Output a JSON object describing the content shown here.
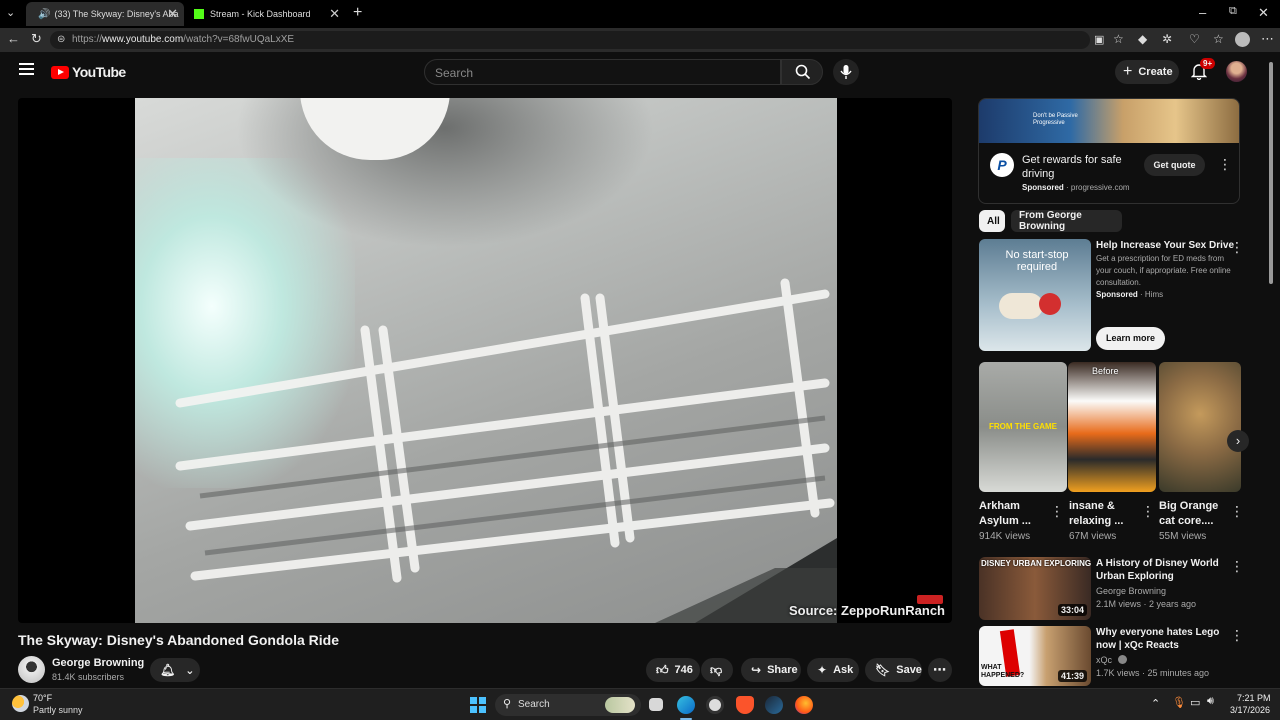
{
  "browser": {
    "tabs": [
      {
        "title": "(33) The Skyway: Disney's Aba",
        "active": true
      },
      {
        "title": "Stream - Kick Dashboard",
        "active": false
      }
    ],
    "url_prefix": "https://",
    "url_domain": "www.youtube.com",
    "url_path": "/watch?v=68fwUQaLxXE"
  },
  "header": {
    "logo": "YouTube",
    "search_placeholder": "Search",
    "create_label": "Create",
    "notification_badge": "9+"
  },
  "video": {
    "title": "The Skyway: Disney's Abandoned Gondola Ride",
    "source_overlay": "Source: ZeppoRunRanch",
    "channel": "George Browning",
    "subscribers": "81.4K subscribers",
    "likes": "746",
    "share_label": "Share",
    "ask_label": "Ask",
    "save_label": "Save"
  },
  "ad": {
    "banner_text": "Don't be Passive Progressive",
    "title": "Get rewards for safe driving",
    "sponsored": "Sponsored",
    "domain": "progressive.com",
    "cta": "Get quote"
  },
  "chips": [
    "All",
    "From George Browning"
  ],
  "promo": {
    "thumb_text": "No start-stop required",
    "title": "Help Increase Your Sex Drive",
    "description": "Get a prescription for ED meds from your couch, if appropriate. Free online consultation.",
    "sponsored": "Sponsored",
    "advertiser": "Hims",
    "cta": "Learn more"
  },
  "shorts": [
    {
      "title": "Arkham Asylum ...",
      "views": "914K views",
      "thumb_text": "FROM THE GAME",
      "color": "#8c8f8a"
    },
    {
      "title": "insane & relaxing ...",
      "views": "67M views",
      "thumb_text": "Before",
      "color": "#3a2a22"
    },
    {
      "title": "Big Orange cat core....",
      "views": "55M views",
      "thumb_text": "",
      "color": "#8a6a44"
    }
  ],
  "recommended": [
    {
      "title": "A History of Disney World Urban Exploring",
      "channel": "George Browning",
      "meta": "2.1M views · 2 years ago",
      "duration": "33:04",
      "thumb_text": "DISNEY URBAN EXPLORING",
      "color": "#5a3a2a"
    },
    {
      "title": "Why everyone hates Lego now | xQc Reacts",
      "channel": "xQc",
      "meta": "1.7K views · 25 minutes ago",
      "duration": "41:39",
      "thumb_text": "WHAT HAPPENED?",
      "color": "#d9d9d9"
    }
  ],
  "taskbar": {
    "temperature": "70°F",
    "condition": "Partly sunny",
    "search_label": "Search",
    "time": "7:21 PM",
    "date": "3/17/2026"
  }
}
